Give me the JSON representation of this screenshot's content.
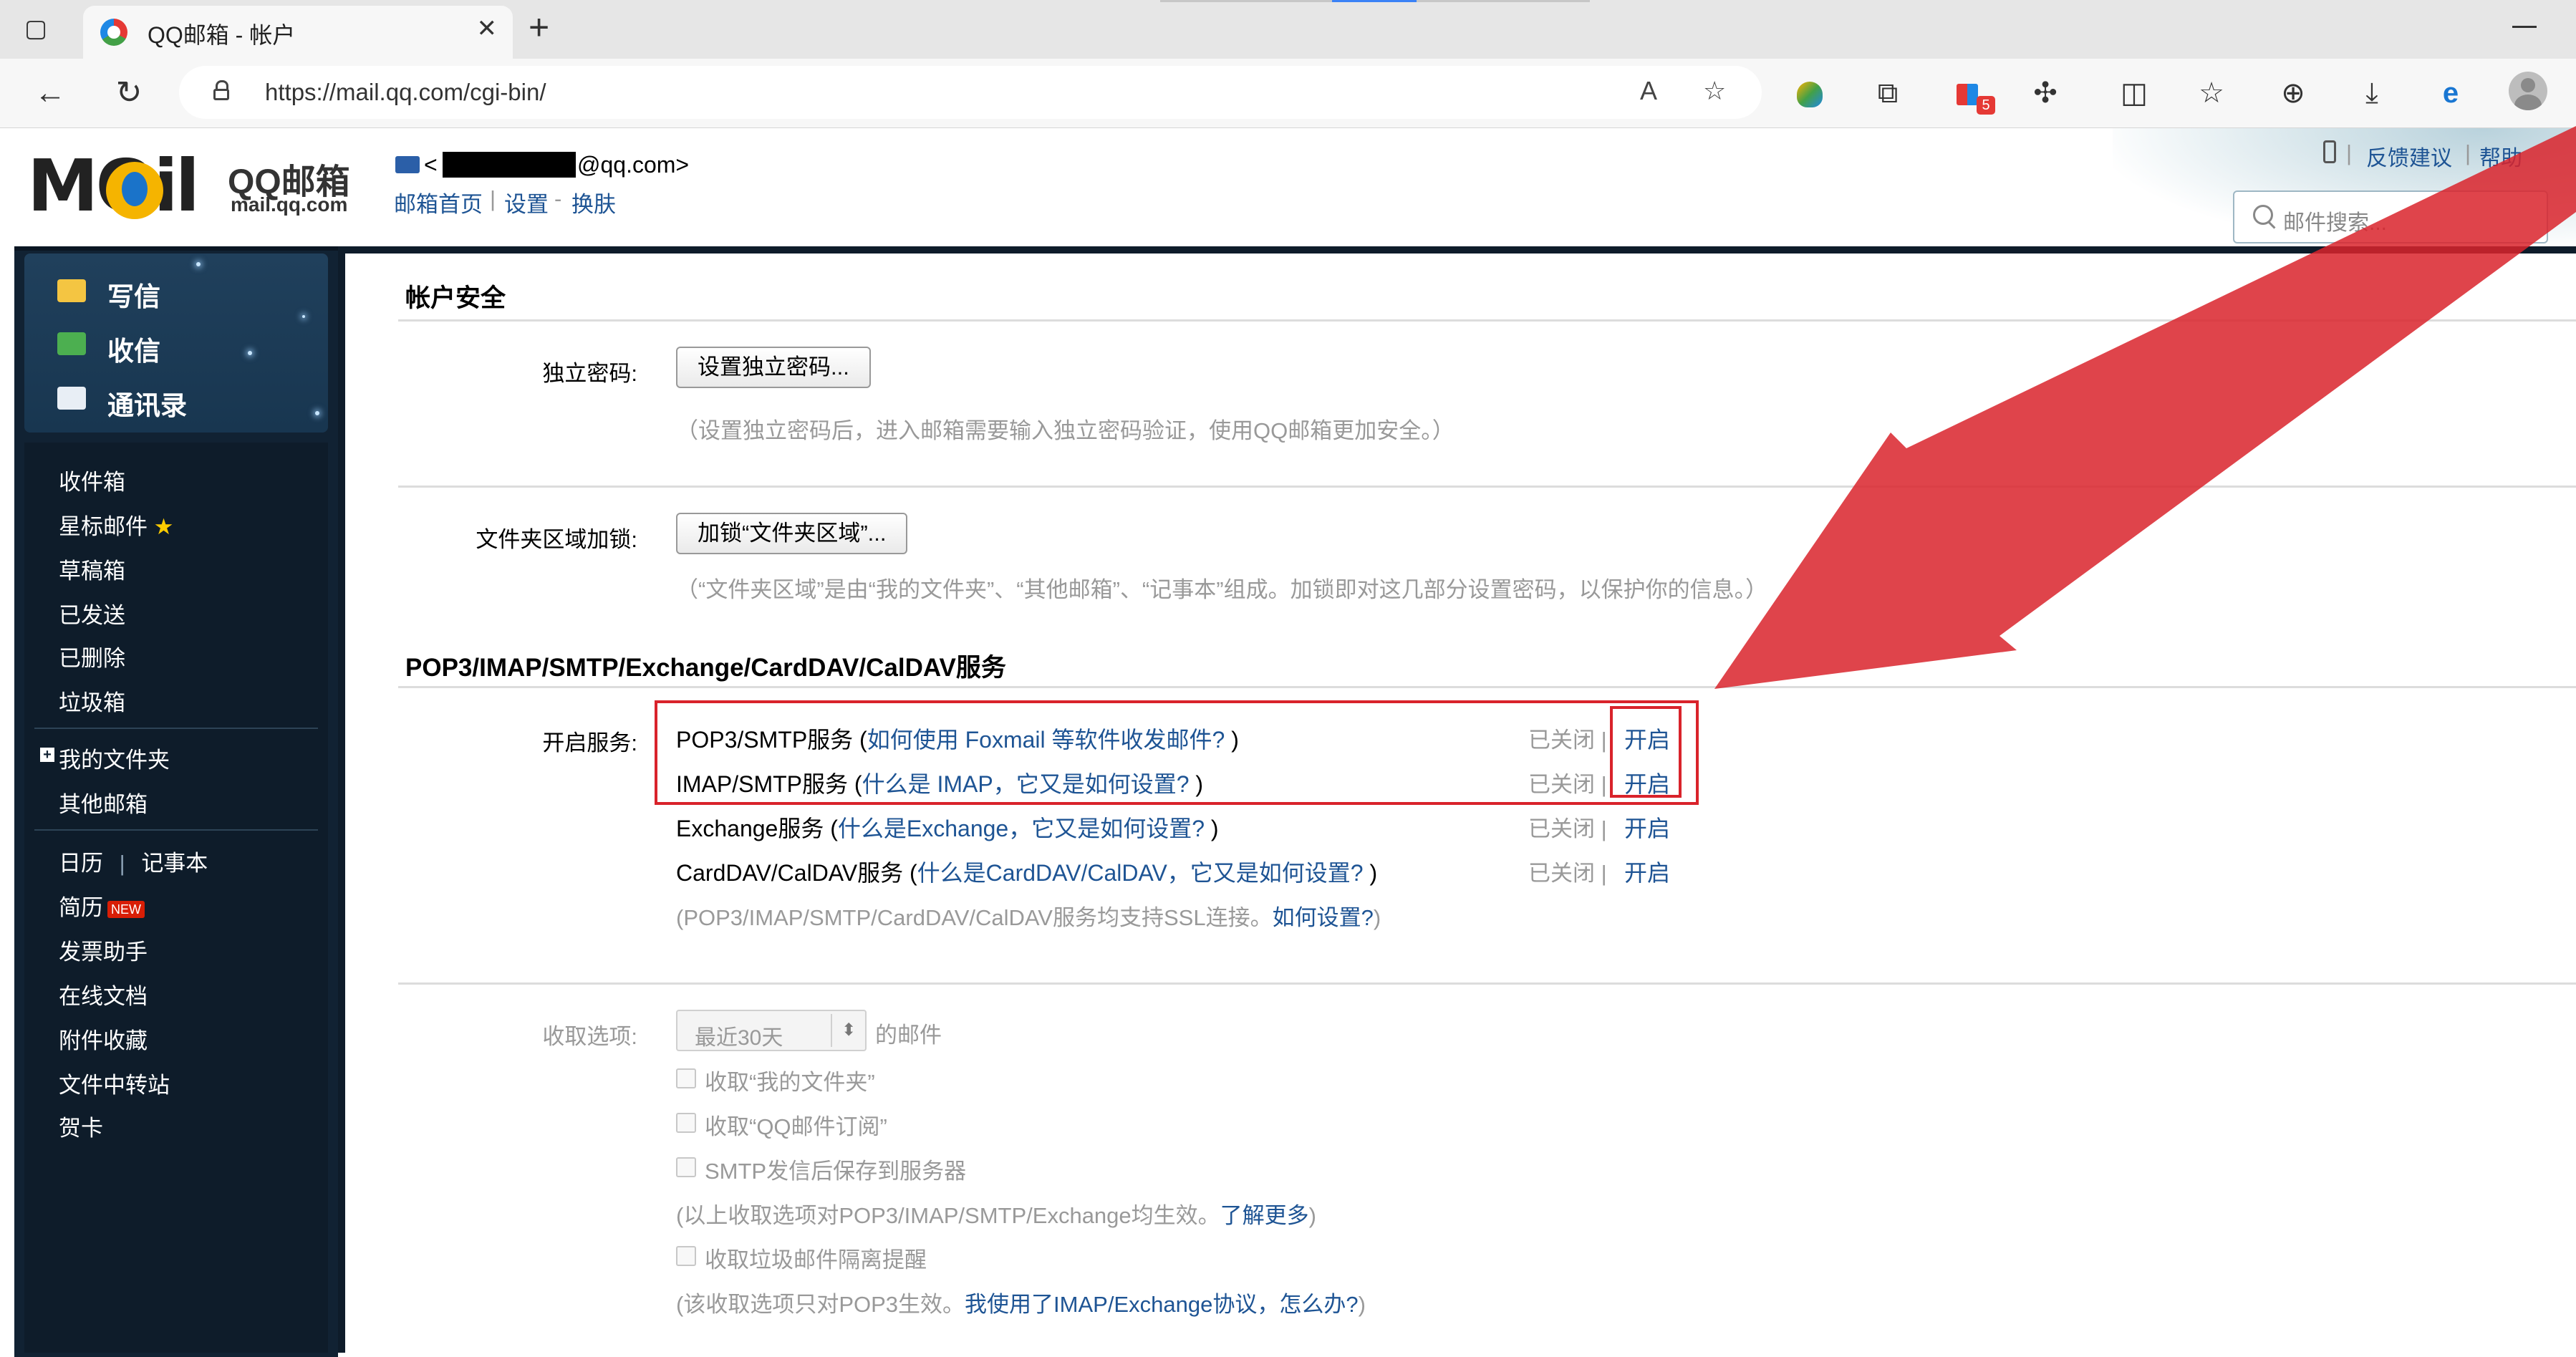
{
  "browser": {
    "tab_title": "QQ邮箱 - 帐户",
    "tab_close": "✕",
    "new_tab": "+",
    "url": "https://mail.qq.com/cgi-bin/",
    "extension_badge": "5",
    "icons": [
      "tab-actions-icon",
      "back-icon",
      "refresh-icon",
      "site-info-lock-icon",
      "read-aloud-icon",
      "add-favorite-icon",
      "extension-shield-icon",
      "collections-icon",
      "extension-puzzle-colored-icon",
      "extensions-icon",
      "split-screen-icon",
      "favorites-icon",
      "add-tab-group-icon",
      "downloads-icon",
      "edge-ie-mode-icon",
      "profile-avatar-icon"
    ]
  },
  "header": {
    "logo_text": "MOil",
    "logo_cn": "QQ邮箱",
    "logo_url": "mail.qq.com",
    "account_prefix": "<",
    "account_suffix": "@qq.com>",
    "links": {
      "home": "邮箱首页",
      "settings": "设置",
      "skin": "换肤"
    },
    "sep1": "|",
    "sep2": "-",
    "feedback": "反馈建议",
    "help": "帮助",
    "search_placeholder": "邮件搜索..."
  },
  "sidebar": {
    "primary": {
      "write": "写信",
      "receive": "收信",
      "contacts": "通讯录"
    },
    "folders": {
      "inbox": "收件箱",
      "starred": "星标邮件",
      "star_glyph": "★",
      "drafts": "草稿箱",
      "sent": "已发送",
      "deleted": "已删除",
      "trash": "垃圾箱"
    },
    "my_folders": "我的文件夹",
    "my_folders_toggle": "+",
    "other_mailbox": "其他邮箱",
    "calendar": "日历",
    "calendar_sep": "|",
    "notebook": "记事本",
    "resume": "简历",
    "new_badge": "NEW",
    "invoice": "发票助手",
    "docs": "在线文档",
    "attachments": "附件收藏",
    "file_transfer": "文件中转站",
    "cards": "贺卡"
  },
  "main": {
    "account_security": {
      "title": "帐户安全",
      "password_label": "独立密码:",
      "password_button": "设置独立密码...",
      "password_note": "（设置独立密码后，进入邮箱需要输入独立密码验证，使用QQ邮箱更加安全。）",
      "folder_lock_label": "文件夹区域加锁:",
      "folder_lock_button": "加锁“文件夹区域”...",
      "folder_lock_note": "（“文件夹区域”是由“我的文件夹”、“其他邮箱”、“记事本”组成。加锁即对这几部分设置密码，以保护你的信息。）"
    },
    "services": {
      "title": "POP3/IMAP/SMTP/Exchange/CardDAV/CalDAV服务",
      "enable_label": "开启服务:",
      "rows": [
        {
          "name": "POP3/SMTP服务 (",
          "help": "如何使用 Foxmail 等软件收发邮件?",
          "close": ")",
          "status": "已关闭",
          "sep": "|",
          "action": "开启"
        },
        {
          "name": "IMAP/SMTP服务 (",
          "help": "什么是 IMAP，它又是如何设置?",
          "close": ")",
          "status": "已关闭",
          "sep": "|",
          "action": "开启"
        },
        {
          "name": "Exchange服务 (",
          "help": "什么是Exchange，它又是如何设置?",
          "close": ")",
          "status": "已关闭",
          "sep": "|",
          "action": "开启"
        },
        {
          "name": "CardDAV/CalDAV服务 (",
          "help": "什么是CardDAV/CalDAV，它又是如何设置?",
          "close": ")",
          "status": "已关闭",
          "sep": "|",
          "action": "开启"
        }
      ],
      "ssl_note": "(POP3/IMAP/SMTP/CardDAV/CalDAV服务均支持SSL连接。",
      "ssl_link": "如何设置?",
      "ssl_close": ")"
    },
    "receive": {
      "label": "收取选项:",
      "select_value": "最近30天",
      "select_arrow": "⬍",
      "select_suffix": "的邮件",
      "opt_my_folders": "收取“我的文件夹”",
      "opt_subscriptions": "收取“QQ邮件订阅”",
      "opt_smtp_save": "SMTP发信后保存到服务器",
      "note1": "(以上收取选项对POP3/IMAP/SMTP/Exchange均生效。",
      "note1_link": "了解更多",
      "note1_close": ")",
      "opt_spam": "收取垃圾邮件隔离提醒",
      "note2": "(该收取选项只对POP3生效。",
      "note2_link": "我使用了IMAP/Exchange协议，怎么办?",
      "note2_close": ")"
    }
  },
  "annotation_color": "#d9232b",
  "colors": {
    "link": "#1e5494",
    "sidebar_bg": "#112233",
    "muted": "#999999"
  }
}
